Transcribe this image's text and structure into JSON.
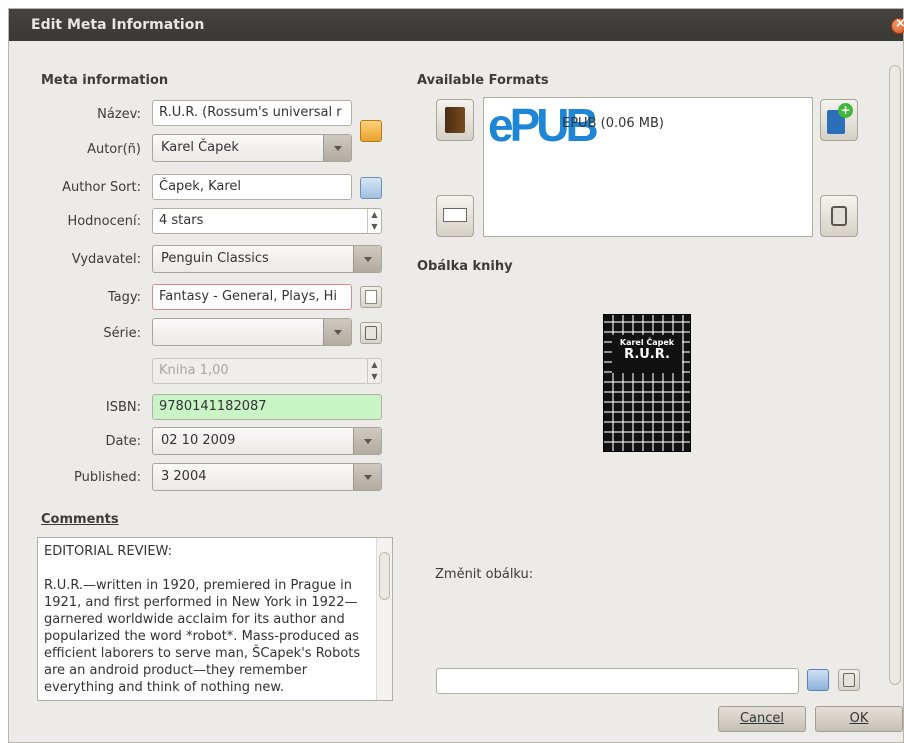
{
  "window": {
    "title": "Edit Meta Information"
  },
  "meta": {
    "section_title": "Meta information",
    "title_label": "Název:",
    "title_value": "R.U.R. (Rossum's universal r",
    "author_label": "Autor(ñ)",
    "author_value": "Karel Čapek",
    "author_sort_label": "Author Sort:",
    "author_sort_value": "Čapek, Karel",
    "rating_label": "Hodnocení:",
    "rating_value": "4 stars",
    "publisher_label": "Vydavatel:",
    "publisher_value": "Penguin Classics",
    "tags_label": "Tagy:",
    "tags_value": "Fantasy - General, Plays, Hi",
    "series_label": "Série:",
    "series_value": "",
    "series_index_value": "Kniha 1,00",
    "isbn_label": "ISBN:",
    "isbn_value": "9780141182087",
    "date_label": "Date:",
    "date_value": "02 10 2009",
    "published_label": "Published:",
    "published_value": "3 2004"
  },
  "comments": {
    "title": "Comments",
    "text": "EDITORIAL REVIEW:\n\nR.U.R.—written in 1920, premiered in Prague in 1921, and first performed in New York in 1922—garnered worldwide acclaim for its author and popularized the word *robot*. Mass-produced as efficient laborers to serve man, ŠCapek's Robots are an android product—they remember everything and think of nothing new."
  },
  "formats": {
    "title": "Available Formats",
    "epub_logo": "ePUB",
    "items": [
      {
        "label": "EPUB (0.06 MB)"
      }
    ]
  },
  "cover": {
    "title": "Obálka knihy",
    "book_author": "Karel Čapek",
    "book_title": "R.U.R.",
    "change_label": "Změnit obálku:",
    "path_value": ""
  },
  "buttons": {
    "cancel": "Cancel",
    "ok": "OK"
  },
  "colors": {
    "titlebar": "#3c3b37",
    "isbn_valid": "#c9f5c6",
    "epub_blue": "#1e86d6",
    "close": "#e05a24"
  },
  "icons": [
    "book-icon",
    "add-format-icon",
    "edit-text-icon",
    "trash-icon",
    "swap-icon",
    "sort-arrow-icon",
    "tag-editor-icon",
    "series-clear-icon",
    "browse-folder-icon",
    "reset-cover-icon",
    "close-icon"
  ]
}
